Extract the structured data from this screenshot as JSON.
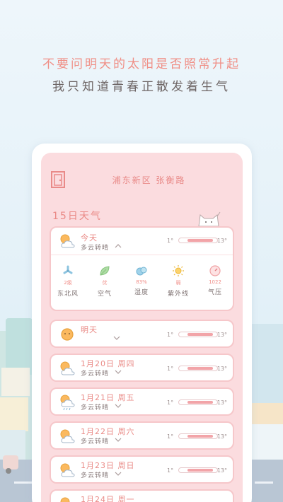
{
  "slogan": {
    "line1": "不要问明天的太阳是否照常升起",
    "line2": "我只知道青春正散发着生气"
  },
  "colors": {
    "accent": "#ea8985",
    "card_bg": "#ffffff",
    "screen_bg": "#fbdcdf",
    "card_border": "#f6c7ca"
  },
  "header": {
    "location": "浦东新区 张衡路",
    "section_title": "15日天气"
  },
  "today": {
    "name": "今天",
    "condition": "多云转晴",
    "temp_min": "1°",
    "temp_max": "13°",
    "icon": "cloudy-sun-icon",
    "metrics": [
      {
        "icon": "wind-icon",
        "value": "2级",
        "label": "东北风"
      },
      {
        "icon": "leaf-icon",
        "value": "优",
        "label": "空气"
      },
      {
        "icon": "humidity-icon",
        "value": "83%",
        "label": "湿度"
      },
      {
        "icon": "sun-uv-icon",
        "value": "弱",
        "label": "紫外线"
      },
      {
        "icon": "pressure-icon",
        "value": "1022",
        "label": "气压"
      }
    ]
  },
  "forecast": [
    {
      "name": "明天",
      "condition": "",
      "temp_min": "1°",
      "temp_max": "13°",
      "icon": "sunny-icon"
    },
    {
      "name": "1月20日 周四",
      "condition": "多云转晴",
      "temp_min": "1°",
      "temp_max": "13°",
      "icon": "cloudy-sun-icon"
    },
    {
      "name": "1月21日 周五",
      "condition": "多云转晴",
      "temp_min": "1°",
      "temp_max": "13°",
      "icon": "rainy-sun-icon"
    },
    {
      "name": "1月22日 周六",
      "condition": "多云转晴",
      "temp_min": "1°",
      "temp_max": "13°",
      "icon": "cloudy-sun-icon"
    },
    {
      "name": "1月23日 周日",
      "condition": "多云转晴",
      "temp_min": "1°",
      "temp_max": "13°",
      "icon": "cloudy-sun-icon"
    },
    {
      "name": "1月24日 周一",
      "condition": "",
      "temp_min": "",
      "temp_max": "",
      "icon": "cloudy-sun-icon"
    }
  ]
}
